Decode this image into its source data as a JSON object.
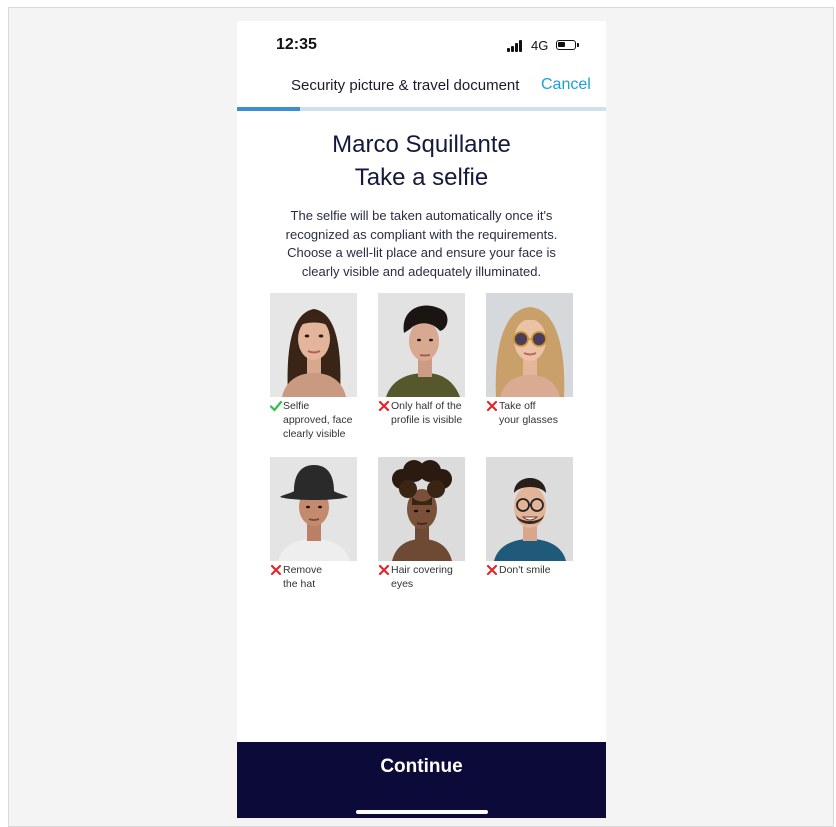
{
  "status_bar": {
    "time": "12:35",
    "network": "4G"
  },
  "header": {
    "title": "Security picture & travel document",
    "cancel_label": "Cancel",
    "progress_fraction": 0.17
  },
  "main": {
    "name": "Marco Squillante",
    "title": "Take a selfie",
    "description": "The selfie will be taken automatically once it's recognized as compliant with the requirements. Choose a well-lit place and ensure your face is clearly visible and adequately illuminated."
  },
  "examples": [
    {
      "status": "ok",
      "caption_lines": [
        "Selfie",
        "approved, face",
        "clearly visible"
      ]
    },
    {
      "status": "error",
      "caption_lines": [
        "Only half of the",
        "profile is visible"
      ]
    },
    {
      "status": "error",
      "caption_lines": [
        "Take off",
        "your glasses"
      ]
    },
    {
      "status": "error",
      "caption_lines": [
        "Remove",
        "the hat"
      ]
    },
    {
      "status": "error",
      "caption_lines": [
        "Hair covering",
        "eyes"
      ]
    },
    {
      "status": "error",
      "caption_lines": [
        "Don't smile"
      ]
    }
  ],
  "footer": {
    "continue_label": "Continue"
  },
  "colors": {
    "accent": "#1aa0d8",
    "progress": "#3a8fd0",
    "footer_bg": "#0b0a38",
    "ok": "#2bc24a",
    "error": "#e3262a"
  }
}
